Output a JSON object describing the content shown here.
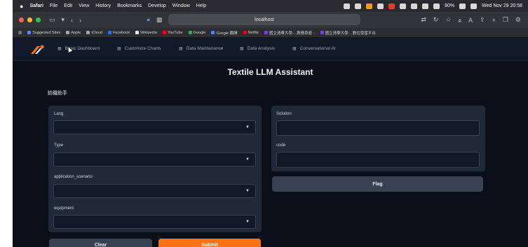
{
  "menubar": {
    "app": "Safari",
    "items": [
      "File",
      "Edit",
      "View",
      "History",
      "Bookmarks",
      "Develop",
      "Window",
      "Help"
    ],
    "battery": "80%",
    "clock": "Wed Nov 29  20:58"
  },
  "browser": {
    "url": "localhost",
    "bookmarks": [
      "Suggested Sites",
      "Apple",
      "iCloud",
      "Facebook",
      "Wikipedia",
      "YouTube",
      "Google",
      "Google 翻譯",
      "Netflix",
      "國立清華大學-...教務系統 -",
      "國立清華大學 ...數位學習平台"
    ]
  },
  "nav": {
    "items": [
      "Basic Dashboard",
      "Customize Charts",
      "Data Maintenance",
      "Data Analysis",
      "Conversational AI"
    ]
  },
  "page": {
    "title": "Textile LLM Assistant",
    "subtitle": "紡織助手"
  },
  "form": {
    "fields": [
      {
        "label": "Lang",
        "value": ""
      },
      {
        "label": "Type",
        "value": ""
      },
      {
        "label": "application_scenario",
        "value": ""
      },
      {
        "label": "equipment",
        "value": ""
      }
    ],
    "clear_label": "Clear",
    "submit_label": "Submit"
  },
  "output": {
    "solution_label": "Solution",
    "solution_value": "",
    "code_label": "code",
    "code_value": "",
    "flag_label": "Flag"
  },
  "colors": {
    "background": "#0b0f19",
    "panel": "#1f2937",
    "accent": "#f97316"
  }
}
